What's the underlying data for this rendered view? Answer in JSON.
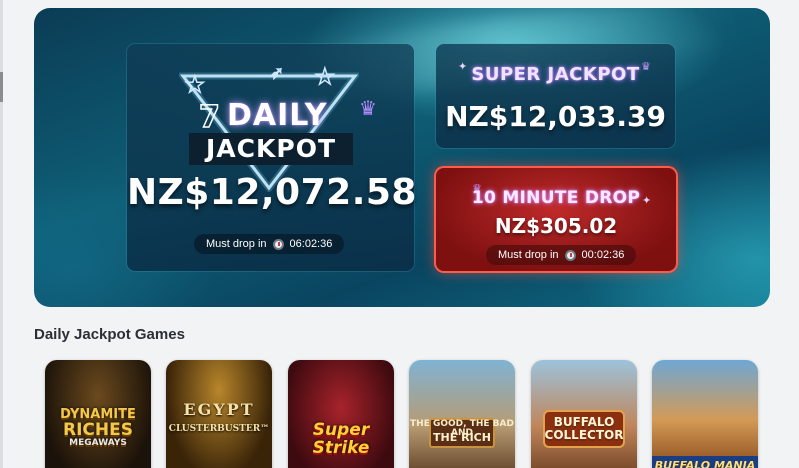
{
  "banner": {
    "daily": {
      "logo_word": "DAILY",
      "logo_box": "JACKPOT",
      "amount": "NZ$12,072.58",
      "drop_label": "Must drop in",
      "drop_time": "06:02:36"
    },
    "super": {
      "title": "SUPER JACKPOT",
      "amount": "NZ$12,033.39"
    },
    "ten_minute": {
      "title": "10 MINUTE DROP",
      "amount": "NZ$305.02",
      "drop_label": "Must drop in",
      "drop_time": "00:02:36"
    }
  },
  "section": {
    "title": "Daily Jackpot Games"
  },
  "games": [
    {
      "title_line1": "DYNAMITE",
      "title_line2": "RICHES",
      "title_line3": "MEGAWAYS"
    },
    {
      "title": "EGYPT",
      "subtitle": "CLUSTERBUSTER™"
    },
    {
      "title": "Super Strike"
    },
    {
      "title": "THE GOOD, THE BAD AND",
      "subtitle": "THE RICH"
    },
    {
      "title_line1": "BUFFALO",
      "title_line2": "COLLECTOR"
    },
    {
      "title": "BUFFALO MANIA"
    }
  ],
  "colors": {
    "ten_minute_glow": "#ff5b4a",
    "neon_purple": "#b070ff",
    "page_bg": "#f2f3f5"
  }
}
